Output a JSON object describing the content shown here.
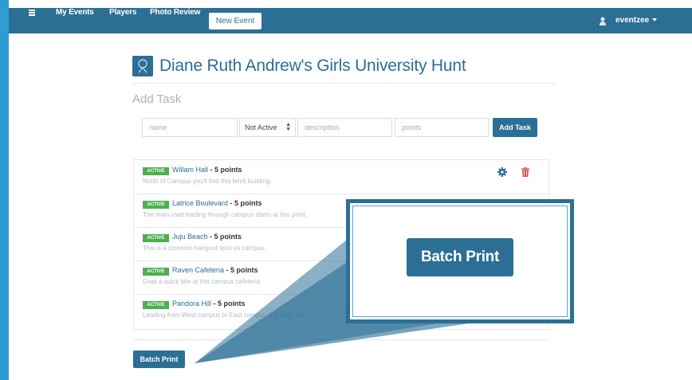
{
  "nav": {
    "items": [
      "My Events",
      "Players",
      "Photo Review"
    ],
    "active": "New Event",
    "user": "eventzee"
  },
  "event": {
    "title": "Diane Ruth Andrew's Girls University Hunt"
  },
  "add_task": {
    "heading": "Add Task",
    "name_placeholder": "name",
    "status_value": "Not Active",
    "description_placeholder": "description",
    "points_placeholder": "points",
    "button": "Add Task"
  },
  "tasks": [
    {
      "status": "ACTIVE",
      "name": "Willam Hall",
      "points": " - 5 points",
      "desc": "North of Campus you'll find this brick building."
    },
    {
      "status": "ACTIVE",
      "name": "Latrice Boulevard",
      "points": " - 5 points",
      "desc": "The main road leading through campus starts at this point."
    },
    {
      "status": "ACTIVE",
      "name": "Juju Beach",
      "points": " - 5 points",
      "desc": "This is a common hangout spot on campus."
    },
    {
      "status": "ACTIVE",
      "name": "Raven Cafeteria",
      "points": " - 5 points",
      "desc": "Grab a quick bite at this campus cafeteria."
    },
    {
      "status": "ACTIVE",
      "name": "Pandora Hill",
      "points": " - 5 points",
      "desc": "Leading from West campus to East campus is a huge hill."
    }
  ],
  "batch_print": "Batch Print",
  "callout": {
    "label": "Batch Print"
  },
  "colors": {
    "nav": "#2b6f95",
    "accent": "#2e9bd3",
    "active_badge": "#4caf50",
    "delete": "#d9534f"
  },
  "icons": {
    "menu": "hamburger-icon",
    "user": "user-icon",
    "logo": "event-logo-icon",
    "edit": "gear-icon",
    "delete": "trash-icon"
  }
}
